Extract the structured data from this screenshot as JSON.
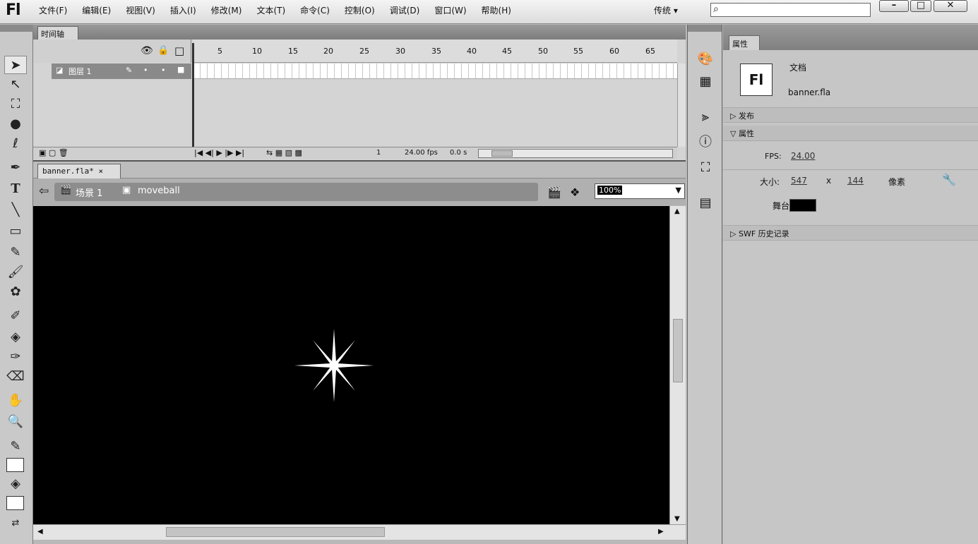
{
  "menubar": {
    "logo": "Fl",
    "items": [
      "文件(F)",
      "编辑(E)",
      "视图(V)",
      "插入(I)",
      "修改(M)",
      "文本(T)",
      "命令(C)",
      "控制(O)",
      "调试(D)",
      "窗口(W)",
      "帮助(H)"
    ],
    "workspace": "传统 ▾",
    "search_placeholder": ""
  },
  "window_buttons": {
    "minimize": "–",
    "restore": "□",
    "close": "✕"
  },
  "timeline": {
    "tab_label": "时间轴",
    "layer_name": "图层 1",
    "ruler_numbers": [
      "5",
      "10",
      "15",
      "20",
      "25",
      "30",
      "35",
      "40",
      "45",
      "50",
      "55",
      "60",
      "65"
    ],
    "frame_number": "1",
    "fps": "24.00 fps",
    "time": "0.0 s"
  },
  "document": {
    "tab_label": "banner.fla* ×",
    "scene_label": "场景 1",
    "symbol_label": "moveball",
    "zoom": "100%",
    "stage_color": "#000000"
  },
  "properties": {
    "tab_label": "属性",
    "doc_type": "文档",
    "doc_icon": "Fl",
    "file_name": "banner.fla",
    "section_publish": "发布",
    "section_properties": "属性",
    "fps_label": "FPS:",
    "fps_value": "24.00",
    "size_label": "大小:",
    "width": "547",
    "x_sep": "x",
    "height": "144",
    "unit": "像素",
    "stage_label": "舞台:",
    "stage_color": "#000000",
    "section_swf": "SWF 历史记录"
  }
}
